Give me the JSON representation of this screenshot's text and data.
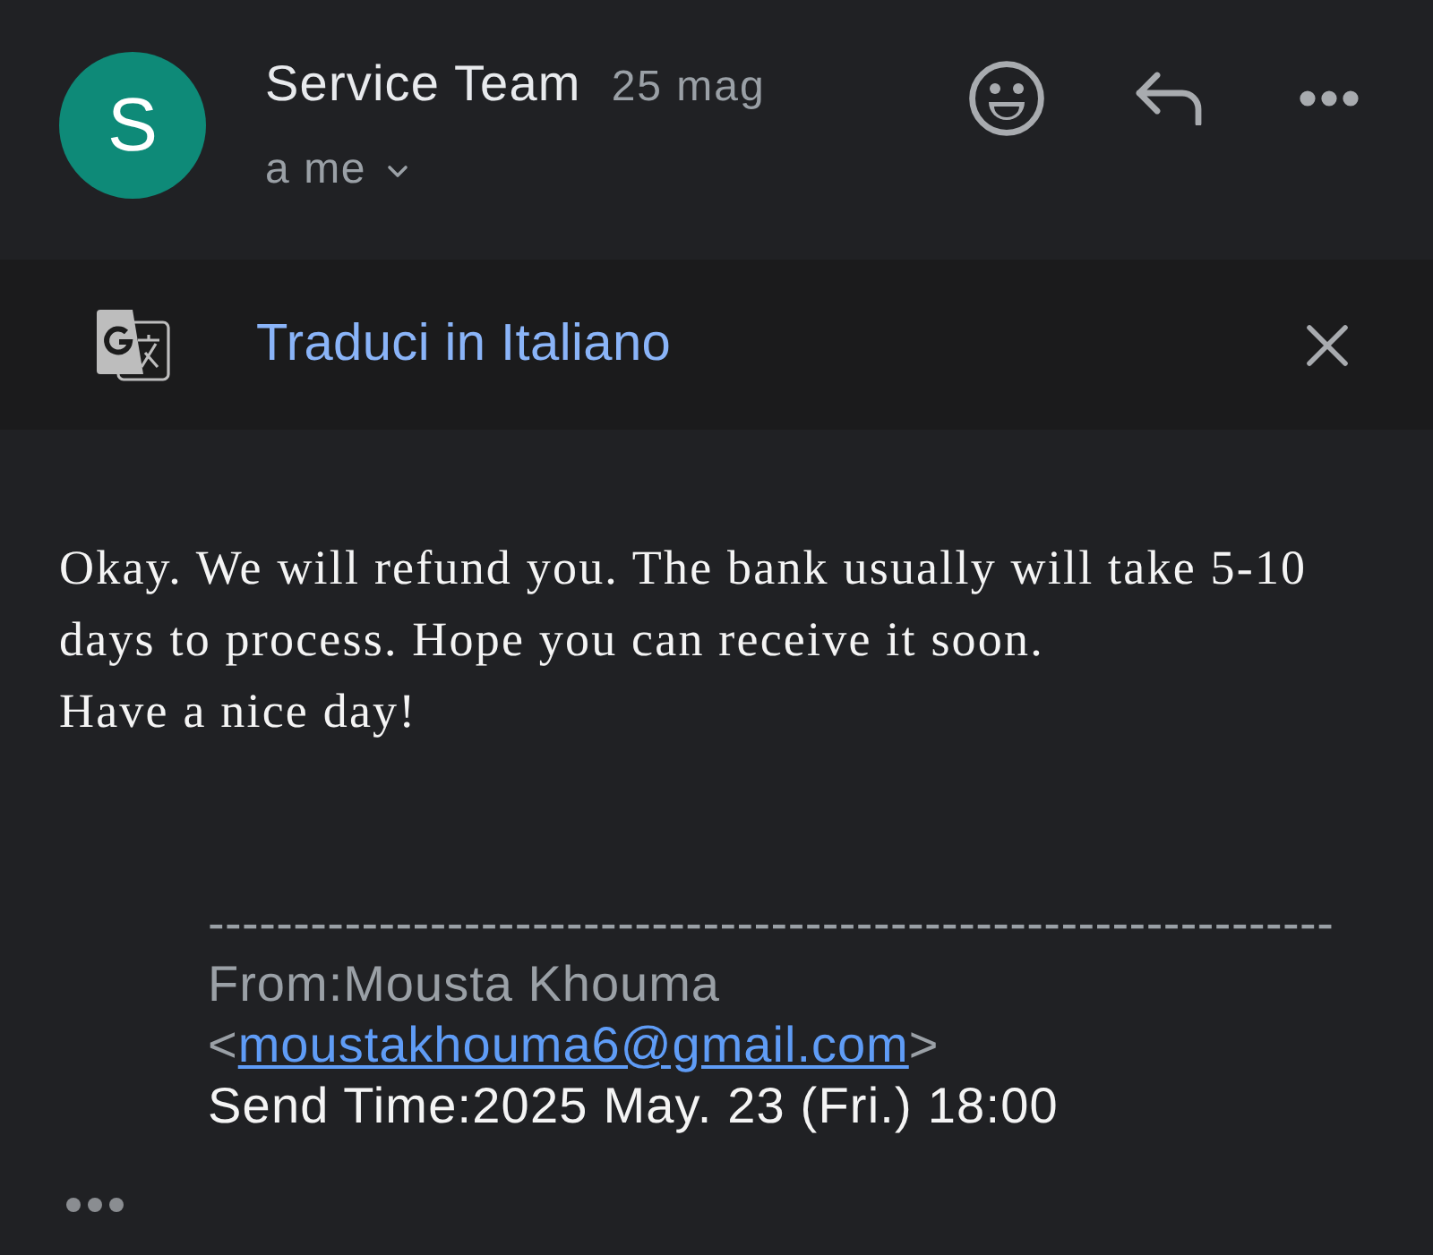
{
  "header": {
    "avatar_letter": "S",
    "sender": "Service Team",
    "date": "25 mag",
    "recipient": "a me"
  },
  "translate_bar": {
    "label": "Traduci in Italiano"
  },
  "body": {
    "paragraphs": [
      "Okay. We will refund you. The bank usually will take 5-10 days to process. Hope you can receive it soon.",
      "Have a nice day!"
    ]
  },
  "quoted": {
    "separator": "------------------------------------------------------------------",
    "from_before": "From:Mousta Khouma <",
    "email": "moustakhouma6@gmail.com",
    "from_after": ">",
    "send_time": "Send Time:2025 May. 23 (Fri.) 18:00"
  }
}
